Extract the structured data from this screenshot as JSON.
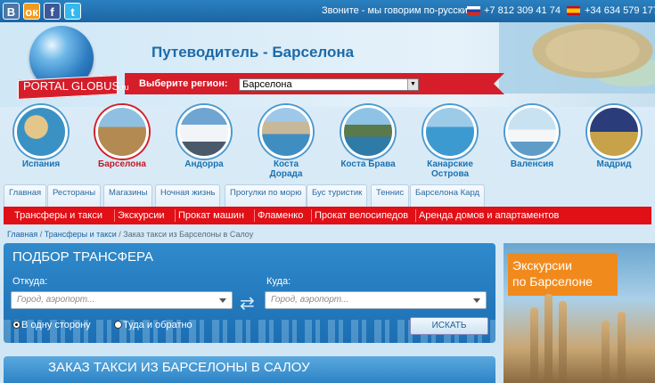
{
  "social": [
    "В",
    "ок",
    "f",
    "t"
  ],
  "topbar": {
    "call_text": "Звоните - мы говорим по-русски",
    "phone_ru": "+7 812 309 41 74",
    "phone_es": "+34 634 579 177"
  },
  "logo": {
    "main": "PORTAL GLOBUS",
    "suffix": ".ru"
  },
  "header": {
    "title": "Путеводитель - Барселона",
    "region_label": "Выберите регион:",
    "region_value": "Барселона"
  },
  "regions": [
    {
      "name": "Испания",
      "color": "#2f8fbf"
    },
    {
      "name": "Барселона",
      "color": "#b38a52"
    },
    {
      "name": "Андорра",
      "color": "#dfe8f1"
    },
    {
      "name": "Коста\nДорада",
      "color": "#4c94c4"
    },
    {
      "name": "Коста Брава",
      "color": "#2f7ba8"
    },
    {
      "name": "Канарские\nОстрова",
      "color": "#3d9ad0"
    },
    {
      "name": "Валенсия",
      "color": "#7fb5d6"
    },
    {
      "name": "Мадрид",
      "color": "#3a4f8f"
    }
  ],
  "tabs": [
    "Главная",
    "Рестораны",
    "Магазины",
    "Ночная жизнь",
    "Прогулки по морю",
    "Бус туристик",
    "Теннис",
    "Барселона Кард"
  ],
  "red_menu": [
    "Трансферы и такси",
    "Экскурсии",
    "Прокат машин",
    "Фламенко",
    "Прокат велосипедов",
    "Аренда домов и апартаментов"
  ],
  "breadcrumb": {
    "home": "Главная",
    "sep": " / ",
    "section": "Трансферы и такси",
    "current": "Заказ такси из Барселоны в Салоу"
  },
  "transfer": {
    "title": "ПОДБОР ТРАНСФЕРА",
    "from_label": "Откуда:",
    "from_placeholder": "Город, аэропорт...",
    "to_label": "Куда:",
    "to_placeholder": "Город, аэропорт...",
    "one_way": "В одну сторону",
    "round_trip": "Туда и обратно",
    "selected": "one_way",
    "search": "ИСКАТЬ"
  },
  "order_title": "ЗАКАЗ ТАКСИ ИЗ БАРСЕЛОНЫ В САЛОУ",
  "banner": {
    "line1": "Экскурсии",
    "line2": "по Барселоне"
  },
  "colors": {
    "accent_red": "#e10f16",
    "brand_blue": "#1d6aa8",
    "banner_orange": "#f18a1d"
  }
}
